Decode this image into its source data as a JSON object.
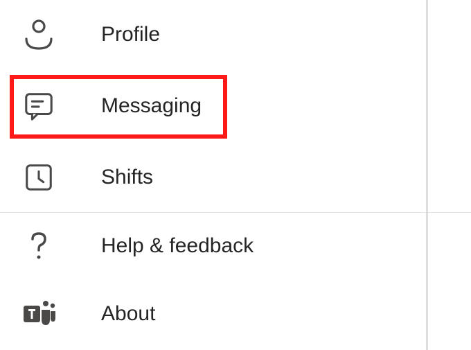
{
  "menu": {
    "items": [
      {
        "key": "profile",
        "label": "Profile",
        "icon": "profile-icon"
      },
      {
        "key": "messaging",
        "label": "Messaging",
        "icon": "messaging-icon"
      },
      {
        "key": "shifts",
        "label": "Shifts",
        "icon": "shifts-icon"
      },
      {
        "key": "help",
        "label": "Help & feedback",
        "icon": "help-icon"
      },
      {
        "key": "about",
        "label": "About",
        "icon": "teams-icon"
      }
    ],
    "highlighted": "messaging",
    "divider_after": "shifts"
  },
  "highlight_color": "#ff1a1a",
  "icon_color": "#4a4948"
}
